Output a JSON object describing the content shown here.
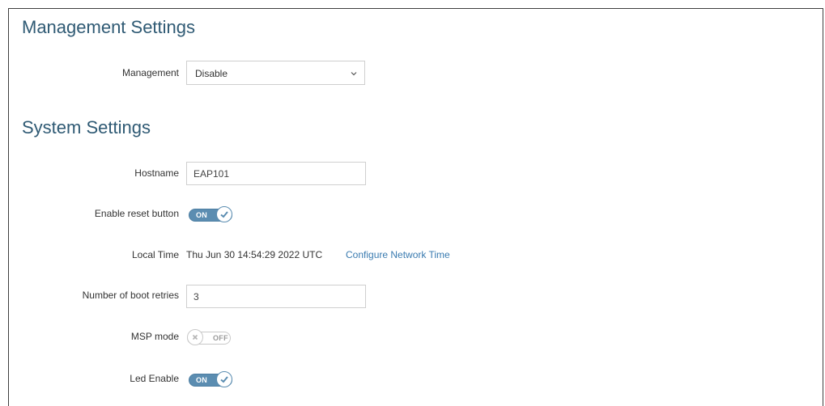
{
  "management_section": {
    "title": "Management Settings",
    "management": {
      "label": "Management",
      "selected": "Disable"
    }
  },
  "system_section": {
    "title": "System Settings",
    "hostname": {
      "label": "Hostname",
      "value": "EAP101"
    },
    "reset_button": {
      "label": "Enable reset button",
      "state": "ON",
      "enabled": true
    },
    "local_time": {
      "label": "Local Time",
      "value": "Thu Jun 30 14:54:29 2022 UTC",
      "link": "Configure Network Time"
    },
    "boot_retries": {
      "label": "Number of boot retries",
      "value": "3"
    },
    "msp_mode": {
      "label": "MSP mode",
      "state": "OFF",
      "enabled": false
    },
    "led_enable": {
      "label": "Led Enable",
      "state": "ON",
      "enabled": true
    }
  },
  "colors": {
    "heading": "#2f5a74",
    "link": "#3a7bb0",
    "toggle_on": "#5b8db1",
    "toggle_off_border": "#c9c9c9"
  },
  "icons": {
    "select_chevron": "chevron-down-icon",
    "toggle_on_knob": "checkmark-icon",
    "toggle_off_knob": "x-icon"
  }
}
